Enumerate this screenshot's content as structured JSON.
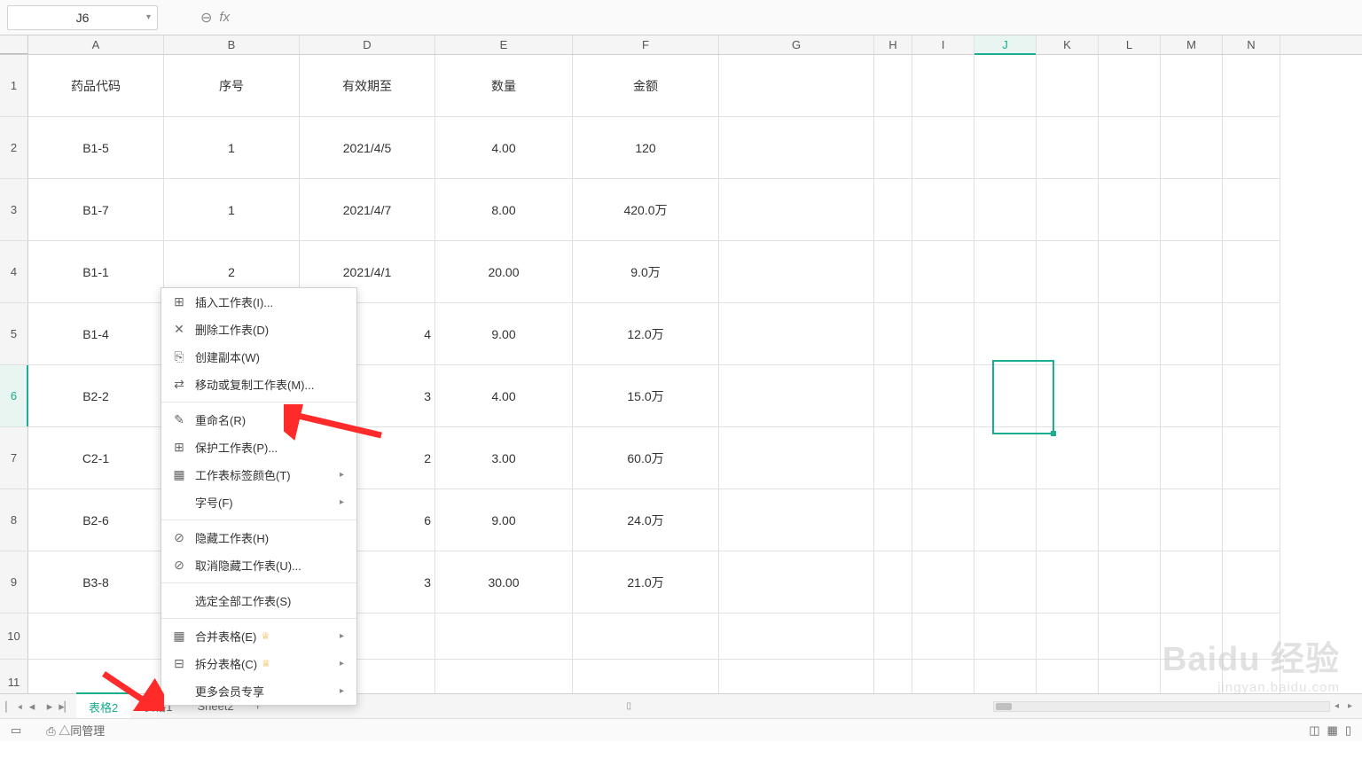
{
  "formula_bar": {
    "cell_ref": "J6",
    "fx_label": "fx",
    "value": ""
  },
  "columns": [
    "A",
    "B",
    "D",
    "E",
    "F",
    "G",
    "H",
    "I",
    "J",
    "K",
    "L",
    "M",
    "N"
  ],
  "active_col": "J",
  "active_row": "6",
  "headers": {
    "A": "药品代码",
    "B": "序号",
    "D": "有效期至",
    "E": "数量",
    "F": "金额"
  },
  "rows": [
    {
      "n": "1",
      "A": "药品代码",
      "B": "序号",
      "D": "有效期至",
      "E": "数量",
      "F": "金额"
    },
    {
      "n": "2",
      "A": "B1-5",
      "B": "1",
      "D": "2021/4/5",
      "E": "4.00",
      "F": "120"
    },
    {
      "n": "3",
      "A": "B1-7",
      "B": "1",
      "D": "2021/4/7",
      "E": "8.00",
      "F": "420.0万"
    },
    {
      "n": "4",
      "A": "B1-1",
      "B": "2",
      "D": "2021/4/1",
      "E": "20.00",
      "F": "9.0万"
    },
    {
      "n": "5",
      "A": "B1-4",
      "B": "",
      "D": "4",
      "E": "9.00",
      "F": "12.0万"
    },
    {
      "n": "6",
      "A": "B2-2",
      "B": "",
      "D": "3",
      "E": "4.00",
      "F": "15.0万"
    },
    {
      "n": "7",
      "A": "C2-1",
      "B": "",
      "D": "2",
      "E": "3.00",
      "F": "60.0万"
    },
    {
      "n": "8",
      "A": "B2-6",
      "B": "",
      "D": "6",
      "E": "9.00",
      "F": "24.0万"
    },
    {
      "n": "9",
      "A": "B3-8",
      "B": "",
      "D": "3",
      "E": "30.00",
      "F": "21.0万"
    },
    {
      "n": "10",
      "A": "",
      "B": "",
      "D": "",
      "E": "",
      "F": ""
    },
    {
      "n": "11",
      "A": "",
      "B": "",
      "D": "",
      "E": "",
      "F": ""
    }
  ],
  "context_menu": [
    {
      "icon": "⊞",
      "label": "插入工作表(I)..."
    },
    {
      "icon": "✕",
      "label": "删除工作表(D)"
    },
    {
      "icon": "⎘",
      "label": "创建副本(W)"
    },
    {
      "icon": "⇄",
      "label": "移动或复制工作表(M)..."
    },
    {
      "sep": true
    },
    {
      "icon": "✎",
      "label": "重命名(R)"
    },
    {
      "icon": "⊞",
      "label": "保护工作表(P)..."
    },
    {
      "icon": "▦",
      "label": "工作表标签颜色(T)",
      "sub": true
    },
    {
      "icon": "",
      "label": "字号(F)",
      "sub": true
    },
    {
      "sep": true
    },
    {
      "icon": "⊘",
      "label": "隐藏工作表(H)"
    },
    {
      "icon": "⊘",
      "label": "取消隐藏工作表(U)..."
    },
    {
      "sep": true
    },
    {
      "icon": "",
      "label": "选定全部工作表(S)"
    },
    {
      "sep": true
    },
    {
      "icon": "▦",
      "label": "合并表格(E)",
      "crown": true,
      "sub": true
    },
    {
      "icon": "⊟",
      "label": "拆分表格(C)",
      "crown": true,
      "sub": true
    },
    {
      "icon": "",
      "label": "更多会员专享",
      "sub": true
    }
  ],
  "sheet_tabs": {
    "active": "表格2",
    "others": [
      "表格1",
      "Sheet2"
    ]
  },
  "status": {
    "left_icon": "▭",
    "mgr": "⎙ △同管理"
  },
  "watermark": {
    "main": "Baidu 经验",
    "sub": "jingyan.baidu.com"
  }
}
